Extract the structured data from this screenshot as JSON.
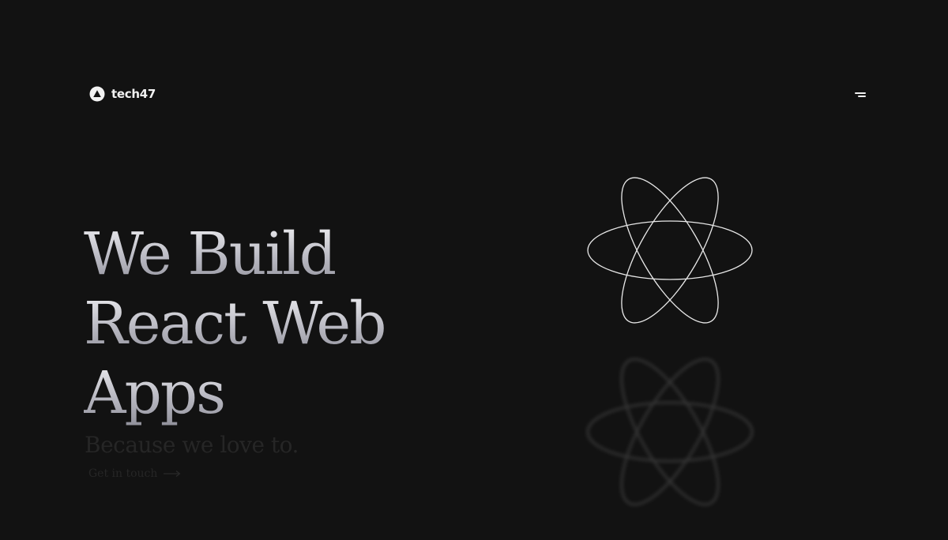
{
  "header": {
    "logo_text": "tech47",
    "logo_icon": "triangle-in-circle-icon",
    "menu_icon": "hamburger-menu-icon"
  },
  "hero": {
    "title_lines": [
      "We Build",
      "React Web",
      "Apps"
    ],
    "subtitle": "Because we love to.",
    "cta_label": "Get in touch",
    "cta_icon": "arrow-right-icon"
  },
  "graphic": {
    "icon": "atom-icon",
    "stroke_color": "#e8e8e8"
  },
  "colors": {
    "background": "#121212",
    "text": "#f2f2f2",
    "muted": "#262626"
  }
}
